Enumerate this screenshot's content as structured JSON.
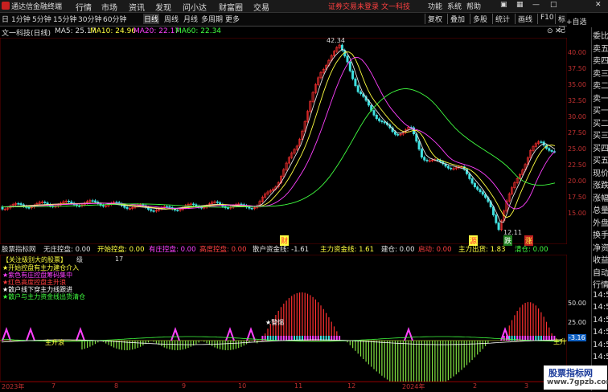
{
  "title_bar": {
    "app_name": "通达信金融终端",
    "menus": [
      "行情",
      "市场",
      "资讯",
      "发现",
      "问小达",
      "财富圈",
      "交易"
    ],
    "promo": [
      "证券交易未登录",
      "文一科技"
    ],
    "right_buttons": [
      "功能",
      "系统",
      "帮助"
    ]
  },
  "toolbar": {
    "periods": [
      "日",
      "1分钟",
      "5分钟",
      "15分钟",
      "30分钟",
      "60分钟",
      "日线",
      "周线",
      "月线",
      "多周期",
      "更多"
    ],
    "active_period": "日线",
    "right_buttons": [
      "复权",
      "叠加",
      "多股",
      "统计",
      "画线",
      "F10",
      "标记"
    ]
  },
  "info_bar": {
    "stock": "文一科技(日线)",
    "ma5": "MA5: 25.17",
    "ma10": "MA10: 24.96",
    "ma20": "MA20: 22.17",
    "ma60": "MA60: 22.34",
    "add_watch": "+自选"
  },
  "price_axis": {
    "ticks": [
      "40.00",
      "37.50",
      "35.00",
      "32.50",
      "30.00",
      "27.50",
      "25.00",
      "22.50",
      "20.00",
      "17.50",
      "15.00"
    ],
    "high_label": "42.34",
    "low_label": "12.11"
  },
  "annotations": {
    "cai": "财",
    "die": "跌",
    "yuan": "源",
    "zhang": "涨"
  },
  "indicator_bar": {
    "name": "股票指标网",
    "items": [
      {
        "text": "无庄控盘: 0.00",
        "color": "#e0e0e0"
      },
      {
        "text": "开始控盘: 0.00",
        "color": "#ffff40"
      },
      {
        "text": "有庄控盘: 0.00",
        "color": "#ff40ff"
      },
      {
        "text": "高度控盘: 0.00",
        "color": "#ff4040"
      },
      {
        "text": "散户资金线: -1.61",
        "color": "#e0e0e0"
      },
      {
        "text": "主力资金线: 1.61",
        "color": "#ffff40"
      },
      {
        "text": "建仓: 0.00",
        "color": "#e0e0e0"
      },
      {
        "text": "启动: 0.00",
        "color": "#ff4040"
      },
      {
        "text": "主力出货: 1.83",
        "color": "#ffff40"
      },
      {
        "text": "清仓: 0.00",
        "color": "#40ff40"
      }
    ]
  },
  "legend": {
    "title": "【关注级别大的股票】",
    "level_label": "级",
    "level_value": "17",
    "items": [
      {
        "text": "★开始控盘有主力建仓介入",
        "color": "#ffff40"
      },
      {
        "text": "★紫色有庄控盘筹码集中",
        "color": "#ff40ff"
      },
      {
        "text": "★红色高度控盘主升浪",
        "color": "#ff4040"
      },
      {
        "text": "★散户线下穿主力线跟进",
        "color": "#ffffff"
      },
      {
        "text": "★散户与主力资金线出货清仓",
        "color": "#40ff40"
      }
    ]
  },
  "ind_axis": {
    "ticks": [
      "50.00",
      "25.00",
      "-3.16"
    ]
  },
  "ind_annotations": {
    "zhusheng": "主升",
    "zhuxing": "主升浪",
    "shanghuo": "★警惕"
  },
  "dates": [
    "2023年",
    "7",
    "8",
    "9",
    "10",
    "11",
    "12",
    "2024年",
    "2",
    "3"
  ],
  "sidebar": [
    "委比",
    "卖五",
    "卖四",
    "卖三",
    "卖二",
    "卖一",
    "买一",
    "买二",
    "买三",
    "买四",
    "买五",
    "现价",
    "涨跌",
    "涨幅",
    "总量",
    "外盘",
    "换手",
    "净资",
    "收益",
    "自动",
    "行情",
    "14:50",
    "14:50",
    "14:50",
    "14:50",
    "14:50",
    "14:50"
  ],
  "watermark": {
    "line1": "股票指标网",
    "line2": "www.7gpzb.com"
  }
}
